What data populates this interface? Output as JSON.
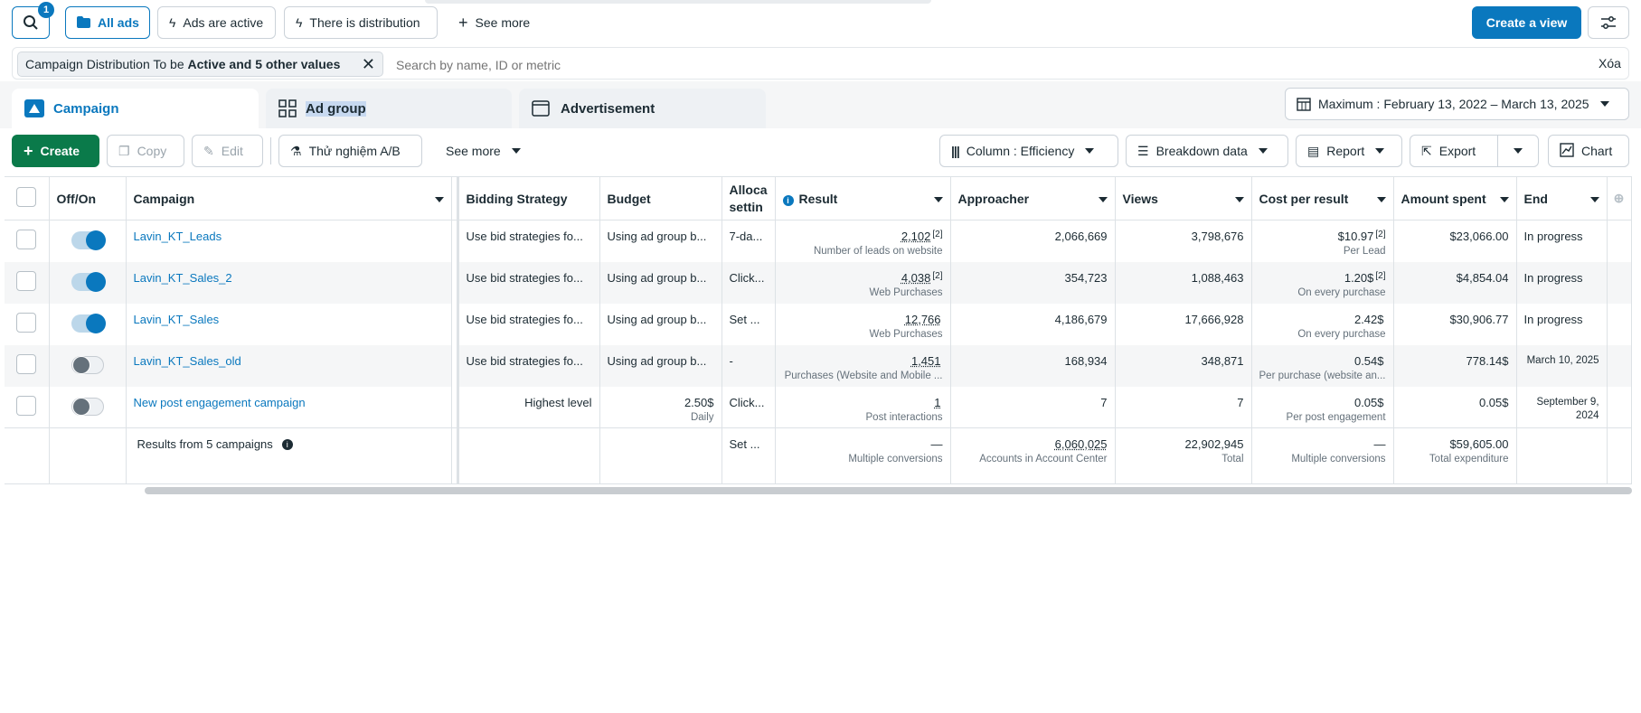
{
  "topbar": {
    "search_badge": "1",
    "all_ads": "All ads",
    "ads_active": "Ads are active",
    "distribution": "There is distribution",
    "see_more": "See more",
    "create_view": "Create a view"
  },
  "filter": {
    "chip_prefix": "Campaign Distribution To be ",
    "chip_bold": "Active and 5 other values",
    "search_placeholder": "Search by name, ID or metric",
    "clear": "Xóa"
  },
  "tabs": {
    "campaign": "Campaign",
    "ad_group": "Ad group",
    "advertisement": "Advertisement",
    "date_range": "Maximum : February 13, 2022 – March 13, 2025"
  },
  "toolbar": {
    "create": "Create",
    "copy": "Copy",
    "edit": "Edit",
    "ab_test": "Thử nghiệm A/B",
    "see_more": "See more",
    "column": "Column : Efficiency",
    "breakdown": "Breakdown data",
    "report": "Report",
    "export": "Export",
    "chart": "Chart"
  },
  "columns": {
    "off_on": "Off/On",
    "campaign": "Campaign",
    "bidding": "Bidding Strategy",
    "budget": "Budget",
    "alloc_1": "Alloca",
    "alloc_2": "settin",
    "result": "Result",
    "approacher": "Approacher",
    "views": "Views",
    "cost": "Cost per result",
    "spent": "Amount spent",
    "end": "End"
  },
  "rows": [
    {
      "name": "Lavin_KT_Leads",
      "bidding": "Use bid strategies fo...",
      "budget": "Using ad group b...",
      "budget_sub": "",
      "alloc": "7-da...",
      "result": "2,102",
      "result_sup": "[2]",
      "result_sub": "Number of leads on website",
      "approacher": "2,066,669",
      "views": "3,798,676",
      "cost": "$10.97",
      "cost_sup": "[2]",
      "cost_sub": "Per Lead",
      "spent": "$23,066.00",
      "end": "In progress"
    },
    {
      "name": "Lavin_KT_Sales_2",
      "bidding": "Use bid strategies fo...",
      "budget": "Using ad group b...",
      "budget_sub": "",
      "alloc": "Click...",
      "result": "4,038",
      "result_sup": "[2]",
      "result_sub": "Web Purchases",
      "approacher": "354,723",
      "views": "1,088,463",
      "cost": "1.20$",
      "cost_sup": "[2]",
      "cost_sub": "On every purchase",
      "spent": "$4,854.04",
      "end": "In progress"
    },
    {
      "name": "Lavin_KT_Sales",
      "bidding": "Use bid strategies fo...",
      "budget": "Using ad group b...",
      "budget_sub": "",
      "alloc": "Set ...",
      "result": "12,766",
      "result_sup": "",
      "result_sub": "Web Purchases",
      "approacher": "4,186,679",
      "views": "17,666,928",
      "cost": "2.42$",
      "cost_sup": "",
      "cost_sub": "On every purchase",
      "spent": "$30,906.77",
      "end": "In progress"
    },
    {
      "name": "Lavin_KT_Sales_old",
      "bidding": "Use bid strategies fo...",
      "budget": "Using ad group b...",
      "budget_sub": "",
      "alloc": "-",
      "result": "1,451",
      "result_sup": "",
      "result_sub": "Purchases (Website and Mobile ...",
      "approacher": "168,934",
      "views": "348,871",
      "cost": "0.54$",
      "cost_sup": "",
      "cost_sub": "Per purchase (website an...",
      "spent": "778.14$",
      "end": "March 10, 2025"
    },
    {
      "name": "New post engagement campaign",
      "bidding": "Highest level",
      "budget": "2.50$",
      "budget_sub": "Daily",
      "alloc": "Click...",
      "result": "1",
      "result_sup": "",
      "result_sub": "Post interactions",
      "approacher": "7",
      "views": "7",
      "cost": "0.05$",
      "cost_sup": "",
      "cost_sub": "Per post engagement",
      "spent": "0.05$",
      "end": "September 9, 2024"
    }
  ],
  "totals": {
    "label": "Results from 5 campaigns",
    "alloc": "Set ...",
    "result": "—",
    "result_sub": "Multiple conversions",
    "approacher": "6,060,025",
    "approacher_sub": "Accounts in Account Center",
    "views": "22,902,945",
    "views_sub": "Total",
    "cost": "—",
    "cost_sub": "Multiple conversions",
    "spent": "$59,605.00",
    "spent_sub": "Total expenditure"
  }
}
